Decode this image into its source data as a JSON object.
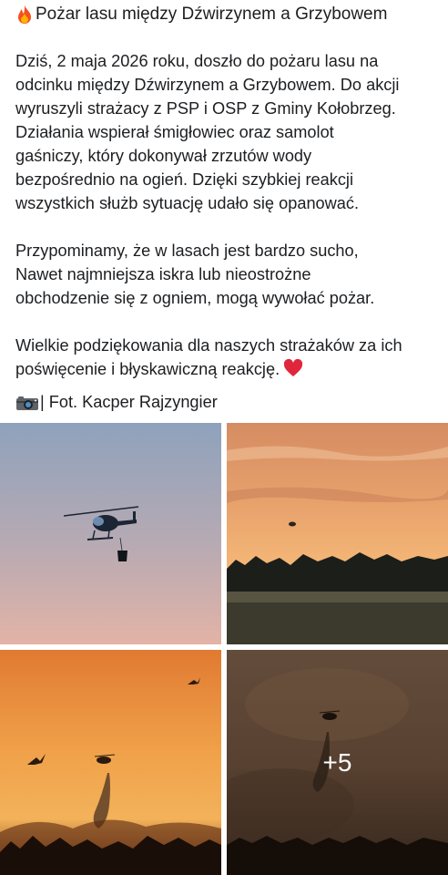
{
  "post": {
    "title": "Pożar lasu między Dźwirzynem a Grzybowem",
    "paragraphs": [
      [
        "Dziś, 2 maja 2026 roku, doszło do pożaru lasu na",
        "odcinku między Dźwirzynem a Grzybowem. Do akcji",
        "wyruszyli strażacy z PSP i OSP z Gminy Kołobrzeg.",
        "Działania wspierał śmigłowiec oraz samolot",
        "gaśniczy, który dokonywał zrzutów wody",
        "bezpośrednio na ogień. Dzięki szybkiej reakcji",
        "wszystkich służb sytuację udało się opanować."
      ],
      [
        "Przypominamy, że w lasach jest bardzo sucho,",
        "Nawet najmniejsza iskra lub nieostrożne",
        "obchodzenie się z ogniem, mogą wywołać pożar."
      ],
      [
        "Wielkie podziękowania dla naszych strażaków za ich",
        "poświęcenie i błyskawiczną reakcję."
      ]
    ],
    "photo_credit": "| Fot. Kacper Rajzyngier"
  },
  "gallery": {
    "photos": [
      {
        "icon": "helicopter-sky-photo"
      },
      {
        "icon": "sunset-forest-photo"
      },
      {
        "icon": "orange-sky-birds-photo"
      },
      {
        "icon": "smoke-water-drop-photo"
      }
    ],
    "more_count_label": "+5"
  },
  "icons": {
    "title": "fire-icon",
    "closing": "red-heart-icon",
    "credit": "camera-icon"
  },
  "colors": {
    "text": "#1c1e21",
    "heart": "#e0263a"
  }
}
